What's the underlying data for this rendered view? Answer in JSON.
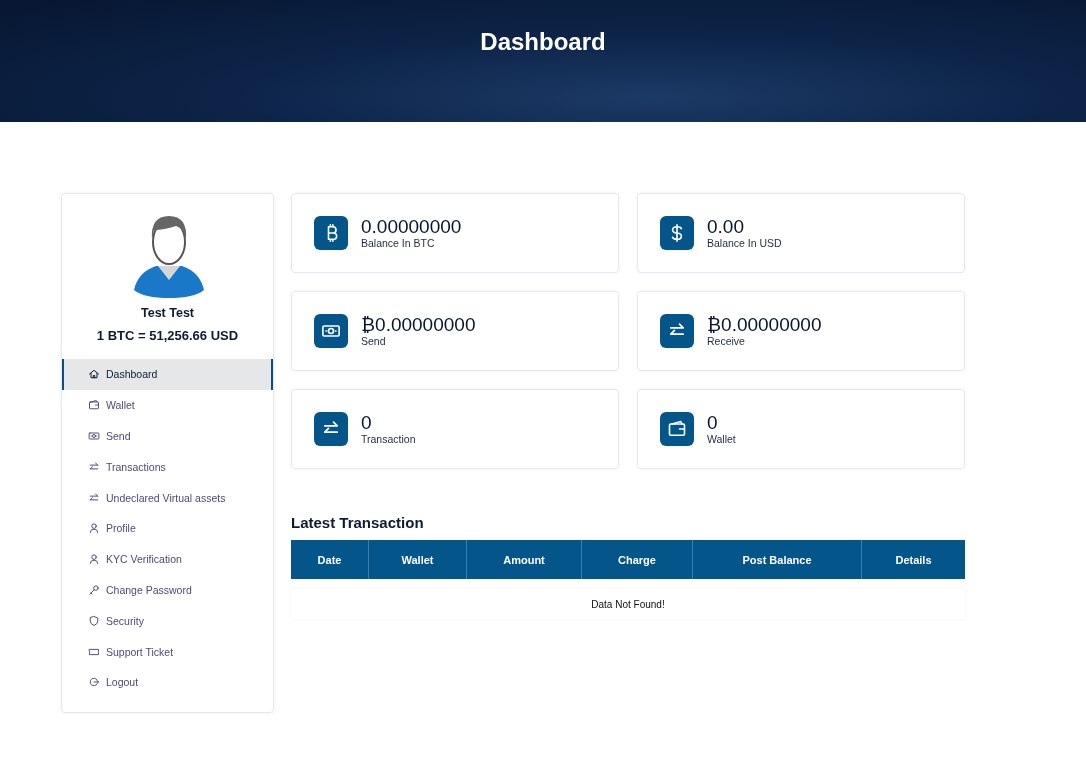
{
  "header": {
    "title": "Dashboard"
  },
  "profile": {
    "name": "Test Test",
    "rate": "1 BTC = 51,256.66 USD"
  },
  "sidebar": {
    "items": [
      {
        "label": "Dashboard",
        "kind": "home",
        "selected": true
      },
      {
        "label": "Wallet",
        "kind": "wallet",
        "selected": false
      },
      {
        "label": "Send",
        "kind": "money",
        "selected": false
      },
      {
        "label": "Transactions",
        "kind": "exchange",
        "selected": false
      },
      {
        "label": "Undeclared Virtual assets",
        "kind": "exchange",
        "selected": false
      },
      {
        "label": "Profile",
        "kind": "user",
        "selected": false
      },
      {
        "label": "KYC Verification",
        "kind": "user",
        "selected": false
      },
      {
        "label": "Change Password",
        "kind": "key",
        "selected": false
      },
      {
        "label": "Security",
        "kind": "shield",
        "selected": false
      },
      {
        "label": "Support Ticket",
        "kind": "ticket",
        "selected": false
      },
      {
        "label": "Logout",
        "kind": "logout",
        "selected": false
      }
    ]
  },
  "cards": [
    {
      "value": "0.00000000",
      "label": "Balance In BTC",
      "kind": "bitcoin"
    },
    {
      "value": "0.00",
      "label": "Balance In USD",
      "kind": "dollar"
    },
    {
      "value": "₿0.00000000",
      "label": "Send",
      "kind": "money"
    },
    {
      "value": "₿0.00000000",
      "label": "Receive",
      "kind": "exchange"
    },
    {
      "value": "0",
      "label": "Transaction",
      "kind": "exchange"
    },
    {
      "value": "0",
      "label": "Wallet",
      "kind": "wallet"
    }
  ],
  "transactions": {
    "title": "Latest Transaction",
    "columns": [
      "Date",
      "Wallet",
      "Amount",
      "Charge",
      "Post Balance",
      "Details"
    ],
    "empty_message": "Data Not Found!"
  }
}
